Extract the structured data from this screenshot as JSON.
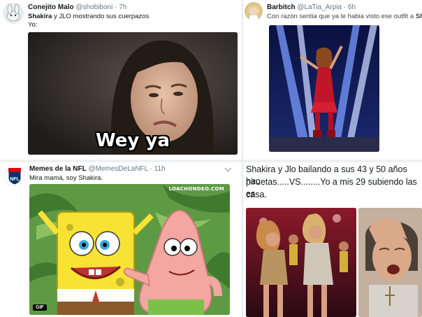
{
  "tweets": [
    {
      "display_name": "Conejito Malo",
      "handle": "@shobiboni",
      "time": "· 7h",
      "text_bold": "Shakira",
      "text_rest": " y JLO mostrando sus cuerpazos",
      "text_line2": "Yo:",
      "image_caption": "Wey ya"
    },
    {
      "display_name": "Barbitch",
      "handle": "@LaTia_Arpia",
      "time": "· 6h",
      "text_rest": "Con razón sentia que ya le habia visto ese outfit a ",
      "text_bold": "Sh"
    },
    {
      "display_name": "Memes de la NFL",
      "handle": "@MemesDeLaNFL",
      "time": "· 11h",
      "text": "Mira mamá, soy Shakira.",
      "watermark": "LOACHONDEO.COM",
      "badge": "GIF"
    },
    {
      "text_line1": "Shakira y Jlo bailando a sus 43 y 50 años hac",
      "text_line2": "piruetas.....VS........Yo a mis 29 subiendo las es",
      "text_line3": "casa."
    }
  ],
  "colors": {
    "text": "#14171a",
    "muted": "#657786",
    "divider": "#d8dde2",
    "gif_badge": "#000000"
  },
  "icons": [
    "chevron-down-icon"
  ]
}
